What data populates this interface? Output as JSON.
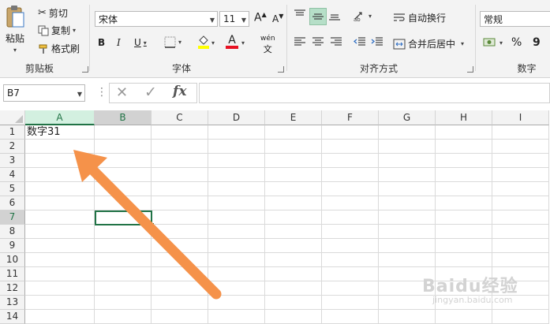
{
  "clipboard": {
    "paste": "粘贴",
    "cut": "剪切",
    "copy": "复制",
    "format_painter": "格式刷",
    "group": "剪贴板"
  },
  "font": {
    "name": "宋体",
    "size": "11",
    "bold": "B",
    "italic": "I",
    "underline": "U",
    "font_color_letter": "A",
    "phonetic": "wén",
    "group": "字体"
  },
  "alignment": {
    "wrap_text": "自动换行",
    "merge_center": "合并后居中",
    "group": "对齐方式"
  },
  "number": {
    "format": "常规",
    "percent": "%",
    "comma": "9",
    "group": "数字"
  },
  "formula_bar": {
    "name_box": "B7",
    "cancel": "✕",
    "enter": "✓",
    "fx": "fx",
    "content": ""
  },
  "columns": [
    "A",
    "B",
    "C",
    "D",
    "E",
    "F",
    "G",
    "H",
    "I"
  ],
  "rows": [
    "1",
    "2",
    "3",
    "4",
    "5",
    "6",
    "7",
    "8",
    "9",
    "10",
    "11",
    "12",
    "13",
    "14"
  ],
  "cells": {
    "A1": "数字31"
  },
  "selected_cell": "B7",
  "annotation": {
    "arrow_color": "#f5924a"
  },
  "watermark": {
    "brand": "Baidu经验",
    "url": "jingyan.baidu.com"
  },
  "colors": {
    "accent_green": "#217346",
    "header_highlight": "#d3f0e0",
    "font_red": "#e81123",
    "fill_yellow": "#ffff00"
  }
}
